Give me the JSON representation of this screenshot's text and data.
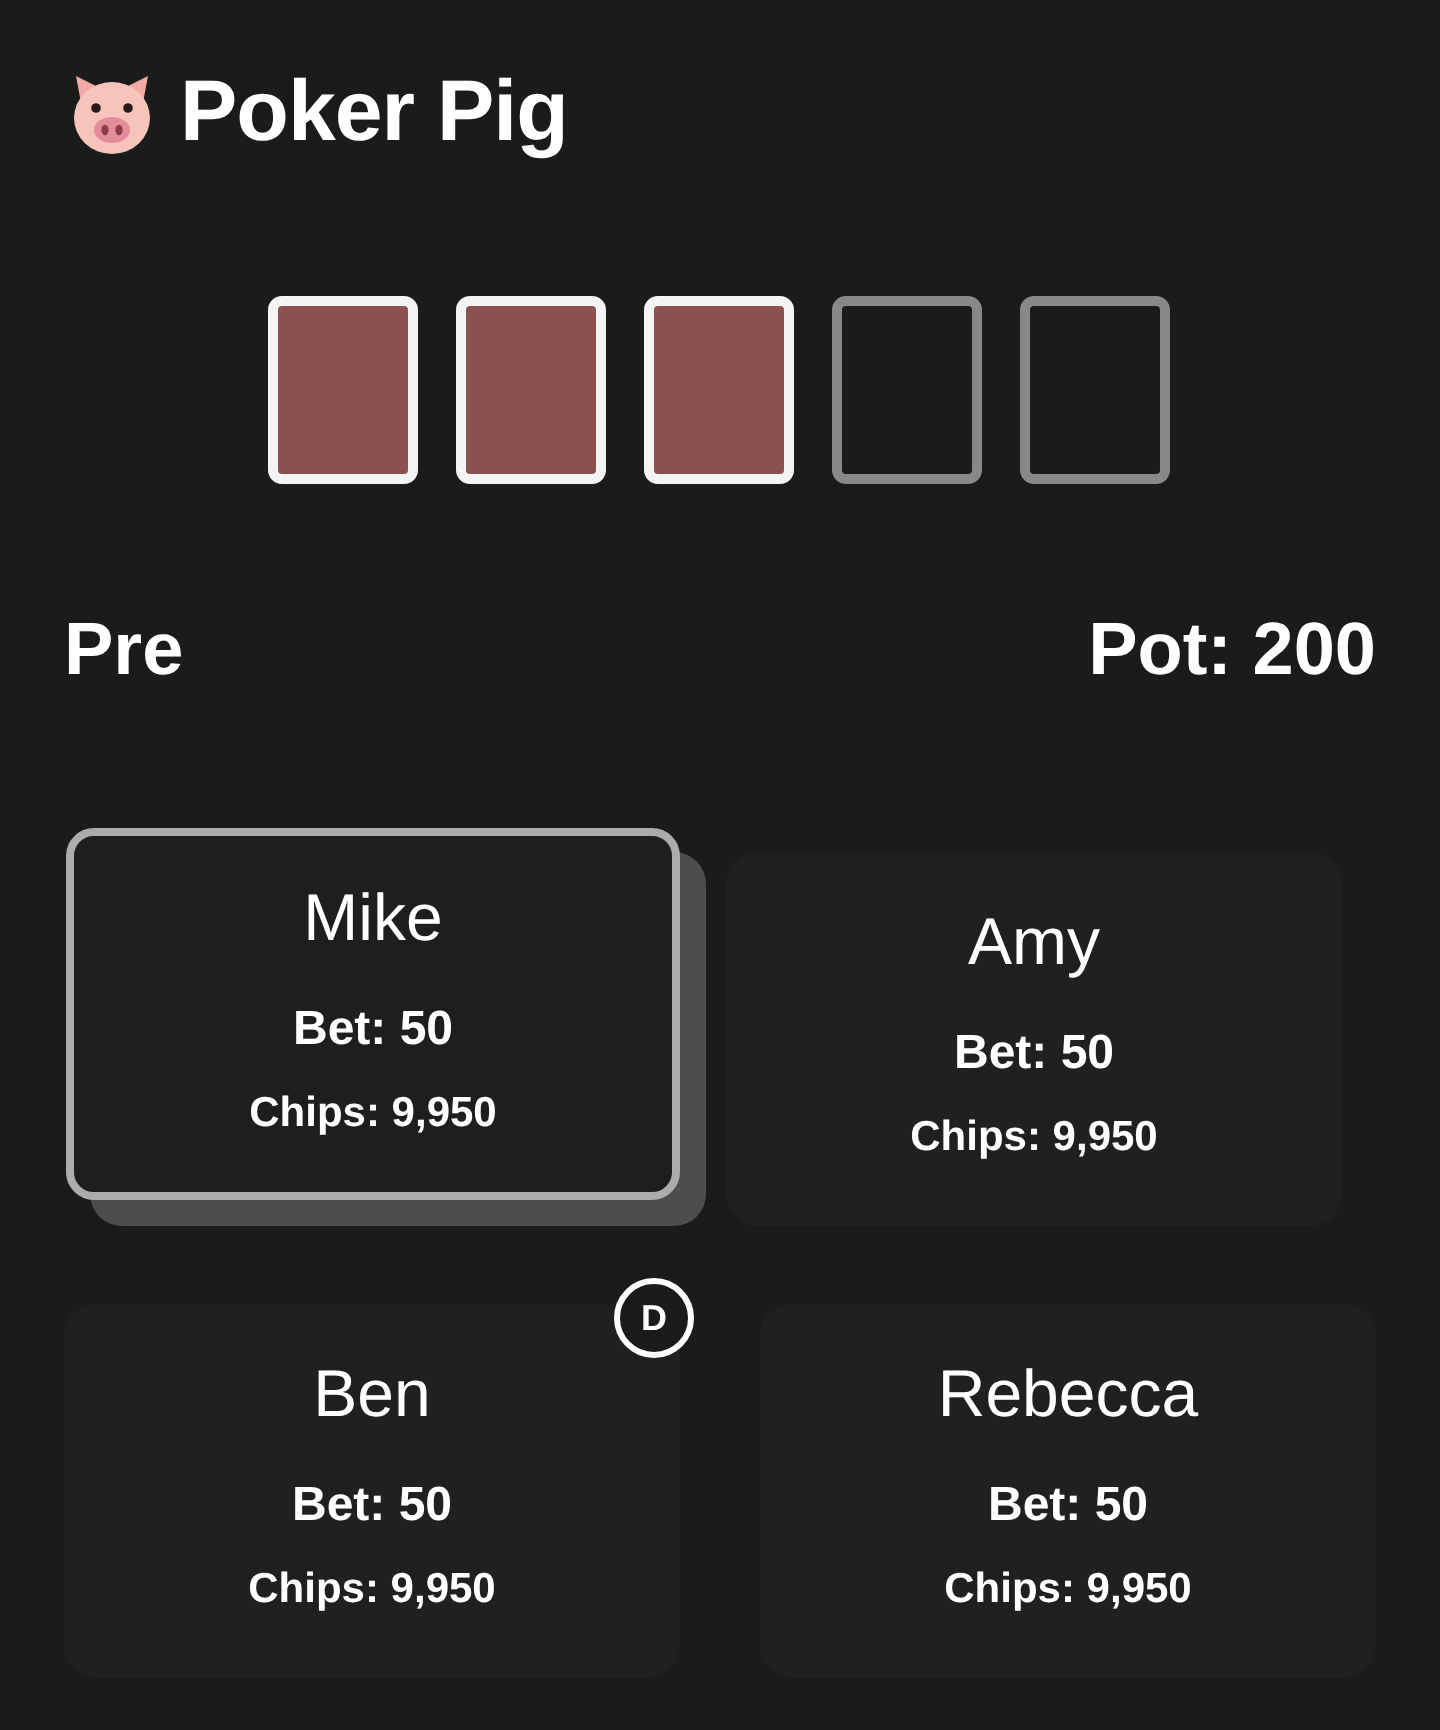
{
  "app": {
    "title": "Poker Pig"
  },
  "board": {
    "cards": [
      {
        "dealt": true
      },
      {
        "dealt": true
      },
      {
        "dealt": true
      },
      {
        "dealt": false
      },
      {
        "dealt": false
      }
    ]
  },
  "round": {
    "stage": "Pre",
    "pot": "Pot: 200"
  },
  "dealer_label": "D",
  "players": [
    {
      "name": "Mike",
      "bet": "Bet: 50",
      "chips": "Chips: 9,950",
      "active": true,
      "dealer": false
    },
    {
      "name": "Amy",
      "bet": "Bet: 50",
      "chips": "Chips: 9,950",
      "active": false,
      "dealer": false
    },
    {
      "name": "Ben",
      "bet": "Bet: 50",
      "chips": "Chips: 9,950",
      "active": false,
      "dealer": true
    },
    {
      "name": "Rebecca",
      "bet": "Bet: 50",
      "chips": "Chips: 9,950",
      "active": false,
      "dealer": false
    }
  ]
}
